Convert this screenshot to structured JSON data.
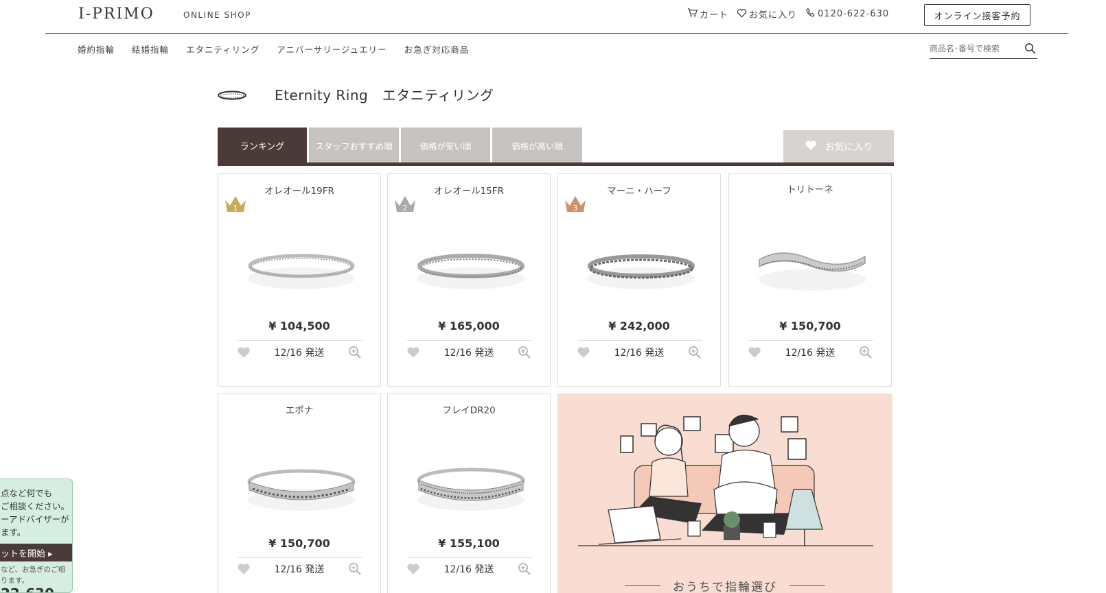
{
  "header": {
    "logo": "I-PRIMO",
    "logo_sub": "ONLINE SHOP",
    "cart": "カート",
    "favorites": "お気に入り",
    "phone": "0120-622-630",
    "reserve": "オンライン接客予約"
  },
  "nav": {
    "items": [
      "婚約指輪",
      "結婚指輪",
      "エタニティリング",
      "アニバーサリージュエリー",
      "お急ぎ対応商品"
    ],
    "search_placeholder": "商品名･番号で検索"
  },
  "page": {
    "title": "Eternity Ring　エタニティリング"
  },
  "tabs": {
    "items": [
      "ランキング",
      "スタッフおすすめ順",
      "価格が安い順",
      "価格が高い順"
    ],
    "active": "ランキング",
    "favorite": "お気に入り"
  },
  "products": [
    {
      "name": "オレオール19FR",
      "price": "¥ 104,500",
      "ship": "12/16 発送",
      "rank": "1",
      "rank_color": "#c9a95a"
    },
    {
      "name": "オレオール15FR",
      "price": "¥ 165,000",
      "ship": "12/16 発送",
      "rank": "2",
      "rank_color": "#a9a9a9"
    },
    {
      "name": "マーニ・ハーフ",
      "price": "¥ 242,000",
      "ship": "12/16 発送",
      "rank": "3",
      "rank_color": "#d2906a"
    },
    {
      "name": "トリトーネ",
      "price": "¥ 150,700",
      "ship": "12/16 発送",
      "rank": "",
      "rank_color": ""
    },
    {
      "name": "エポナ",
      "price": "¥ 150,700",
      "ship": "12/16 発送",
      "rank": "",
      "rank_color": ""
    },
    {
      "name": "フレイDR20",
      "price": "¥ 155,100",
      "ship": "12/16 発送",
      "rank": "",
      "rank_color": ""
    }
  ],
  "banner": {
    "caption": "おうちで指輪選び"
  },
  "chat": {
    "lines": [
      "点など何でも",
      "ご相談ください。",
      "ーアドバイザーが",
      "ます。"
    ],
    "button": "ットを開始 ▸",
    "note_lines": [
      "など、お急ぎのご相",
      "ります。"
    ],
    "tel": "22-630"
  },
  "colors": {
    "accent": "#4a3a38",
    "tab_inactive": "#c7c3c1",
    "banner_bg": "#f9ddd2",
    "chat_bg": "#d5eee1"
  }
}
